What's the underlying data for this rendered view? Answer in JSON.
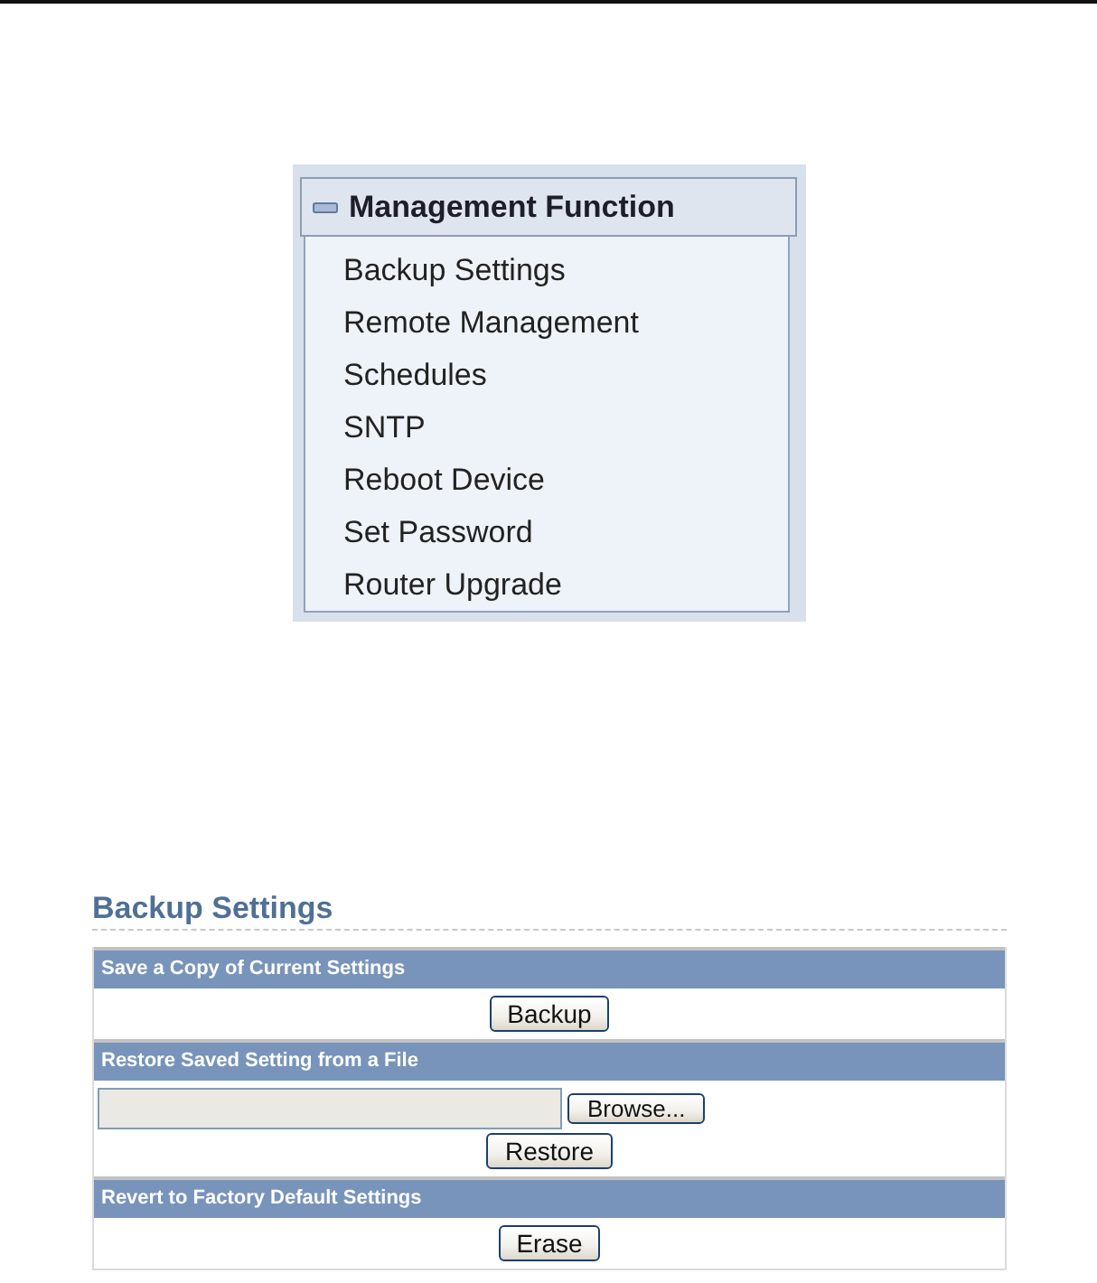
{
  "menu": {
    "title": "Management Function",
    "expanded": true,
    "items": [
      "Backup Settings",
      "Remote Management",
      "Schedules",
      "SNTP",
      "Reboot Device",
      "Set Password",
      "Router Upgrade"
    ]
  },
  "backup_settings": {
    "title": "Backup Settings",
    "sections": [
      {
        "kind": "button",
        "heading": "Save a Copy of Current Settings",
        "buttons": [
          "Backup"
        ]
      },
      {
        "kind": "file-upload",
        "heading": "Restore Saved Setting from a File",
        "file_button": "Browse...",
        "buttons": [
          "Restore"
        ]
      },
      {
        "kind": "button",
        "heading": "Revert to Factory Default Settings",
        "buttons": [
          "Erase"
        ]
      }
    ]
  }
}
